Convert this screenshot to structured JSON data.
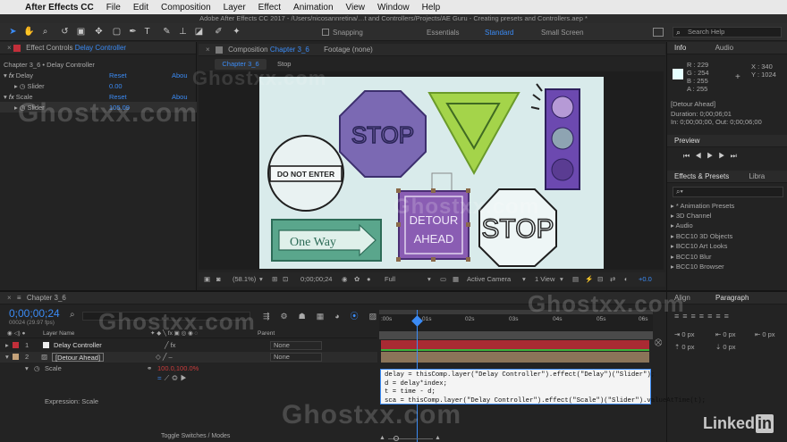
{
  "menubar": {
    "app_name": "After Effects CC",
    "items": [
      "File",
      "Edit",
      "Composition",
      "Layer",
      "Effect",
      "Animation",
      "View",
      "Window",
      "Help"
    ]
  },
  "window_title": "Adobe After Effects CC 2017 - /Users/nicosannretina/…t and Controllers/Projects/AE Guru - Creating presets and Controllers.aep *",
  "toolbar": {
    "snapping_label": "Snapping",
    "workspaces": [
      "Essentials",
      "Standard",
      "Small Screen"
    ],
    "active_workspace": "Standard",
    "search_placeholder": "Search Help"
  },
  "effect_controls": {
    "tab_prefix": "Effect Controls",
    "tab_layer": "Delay Controller",
    "subtitle": "Chapter 3_6 • Delay Controller",
    "effects": [
      {
        "name": "Delay",
        "reset": "Reset",
        "about": "Abou",
        "param": "Slider",
        "value": "0.00"
      },
      {
        "name": "Scale",
        "reset": "Reset",
        "about": "Abou",
        "param": "Slider",
        "value": "105.09"
      }
    ]
  },
  "composition": {
    "tab_prefix": "Composition",
    "tab_name": "Chapter 3_6",
    "footage_tab": "Footage (none)",
    "crumb": "Chapter 3_6",
    "crumb2": "Stop",
    "zoom": "(58.1%)",
    "timecode": "0;00;00;24",
    "resolution": "Full",
    "camera": "Active Camera",
    "views": "1 View",
    "exposure": "+0.0",
    "signs": {
      "stop1": "STOP",
      "do_not_enter": "DO NOT ENTER",
      "one_way": "One Way",
      "detour1": "DETOUR",
      "detour2": "AHEAD",
      "stop2": "STOP"
    }
  },
  "info_panel": {
    "tabs": [
      "Info",
      "Audio"
    ],
    "r": "R : 229",
    "g": "G : 254",
    "b": "B : 255",
    "a": "A : 255",
    "x": "X : 340",
    "y": "Y : 1024",
    "layer_name": "[Detour Ahead]",
    "duration": "Duration: 0;00;06;01",
    "in_out": "In: 0;00;00;00, Out: 0;00;06;00"
  },
  "preview_panel": {
    "title": "Preview"
  },
  "effects_presets": {
    "tabs": [
      "Effects & Presets",
      "Libra"
    ],
    "items": [
      "* Animation Presets",
      "3D Channel",
      "Audio",
      "BCC10 3D Objects",
      "BCC10 Art Looks",
      "BCC10 Blur",
      "BCC10 Browser"
    ]
  },
  "align_panel": {
    "tabs": [
      "Align",
      "Paragraph"
    ],
    "px_values": [
      "0 px",
      "0 px",
      "0 px",
      "0 px",
      "0 px"
    ]
  },
  "timeline": {
    "tab_name": "Chapter 3_6",
    "timecode": "0;00;00;24",
    "frames": "00024 (29.97 fps)",
    "column_layer_name": "Layer Name",
    "column_parent": "Parent",
    "ruler_labels": [
      ":00s",
      "01s",
      "02s",
      "03s",
      "04s",
      "05s",
      "06s"
    ],
    "layers": [
      {
        "num": "1",
        "name": "Delay Controller",
        "parent": "None",
        "color": "#c22f3a"
      },
      {
        "num": "2",
        "name": "[Detour Ahead]",
        "parent": "None",
        "color": "#c4a27a"
      }
    ],
    "scale_prop": "Scale",
    "scale_value": "100.0,100.0%",
    "expression_label": "Expression: Scale",
    "expression_lines": [
      "delay = thisComp.layer(\"Delay Controller\").effect(\"Delay\")(\"Slider\");",
      "d = delay*index;",
      "t = time - d;",
      "sca = thisComp.layer(\"Delay Controller\").effect(\"Scale\")(\"Slider\").valueAtTime(t);"
    ],
    "toggle_label": "Toggle Switches / Modes"
  },
  "watermarks": [
    "Ghostxx.com",
    "Ghostxx.com",
    "Ghostxx.com",
    "Ghostxx.com",
    "Ghostxx.com",
    "Ghostxx.com"
  ],
  "brand": "Linked",
  "brand_in": "in",
  "colors": {
    "accent": "#3b8bf5",
    "artboard": "#d9ebeb",
    "purple": "#7b52ad",
    "green": "#a4d44a"
  }
}
